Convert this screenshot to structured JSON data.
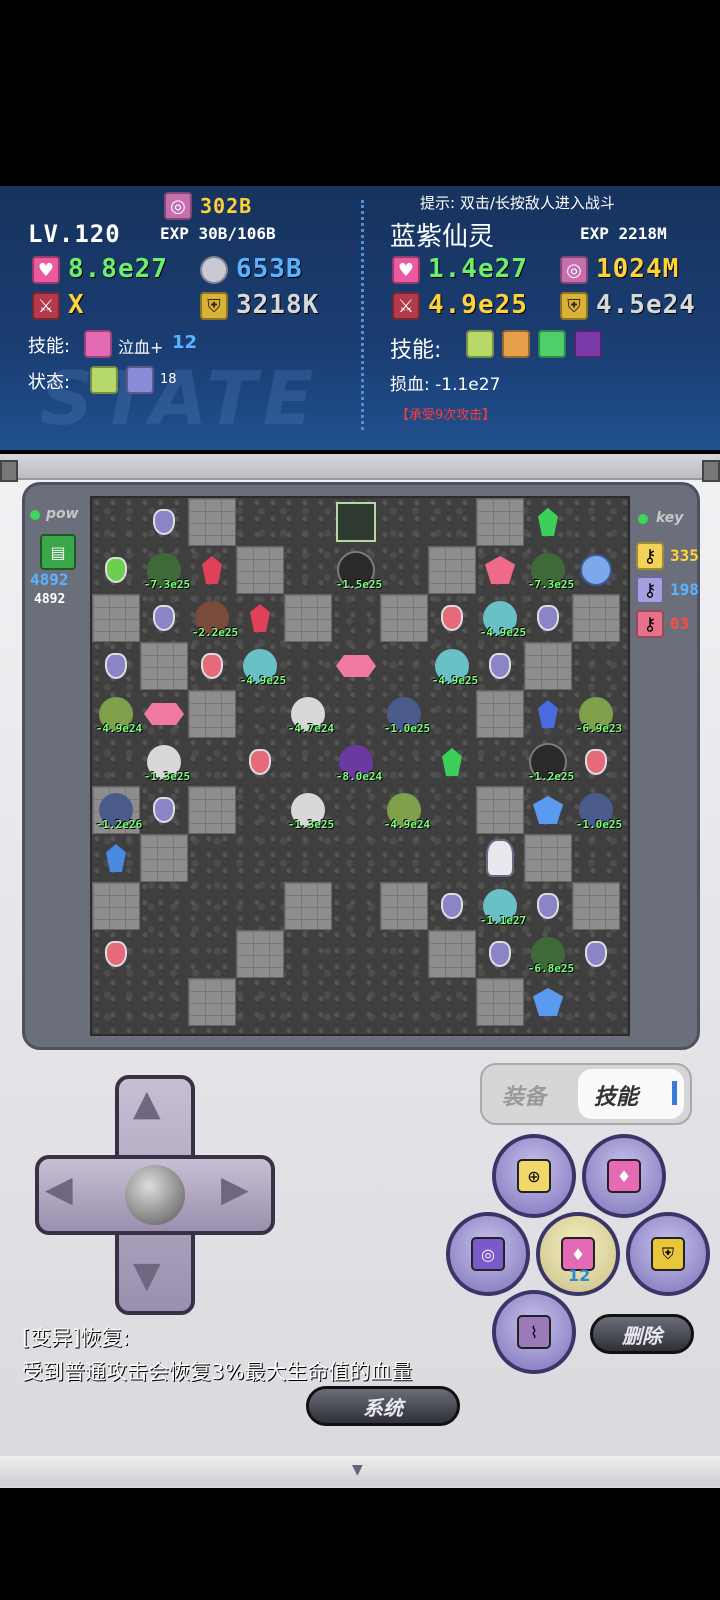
{
  "hero": {
    "gold": "302B",
    "level": "LV.120",
    "exp": "EXP 30B/106B",
    "hp": "8.8e27",
    "mdef": "653B",
    "atk": "X",
    "def": "3218K",
    "skill_label": "技能:",
    "skill_name": "泣血+",
    "skill_level": "12",
    "status_label": "状态:",
    "status_count": "18"
  },
  "enemy": {
    "hint": "提示: 双击/长按敌人进入战斗",
    "name": "蓝紫仙灵",
    "exp": "EXP 2218M",
    "hp": "1.4e27",
    "gold": "1024M",
    "atk": "4.9e25",
    "def": "4.5e24",
    "skill_label": "技能:",
    "damage_label": "损血: ",
    "damage": "-1.1e27",
    "hits": "【承受9次攻击】"
  },
  "watermark": "STATE",
  "side_left": {
    "label": "pow",
    "value1": "4892",
    "value2": "4892"
  },
  "side_right": {
    "label": "key",
    "yellow": "335",
    "blue": "198",
    "red": "03"
  },
  "monster_labels": {
    "m1": "-7.3e25",
    "m2": "-1.5e25",
    "m3": "-7.3e25",
    "m4": "-2.2e25",
    "m5": "-4.9e25",
    "m6": "-4.9e25",
    "m7": "-4.9e25",
    "m8": "-4.9e24",
    "m9": "-4.7e24",
    "m10": "-1.0e25",
    "m11": "-6.9e23",
    "m12": "-1.3e25",
    "m13": "-8.0e24",
    "m14": "-1.2e25",
    "m15": "-1.2e26",
    "m16": "-1.3e25",
    "m17": "-4.9e24",
    "m18": "-1.0e25",
    "m19": "-1.1e27",
    "m20": "-6.8e25"
  },
  "tabs": {
    "equip": "装备",
    "skill": "技能"
  },
  "skill_button_count": "12",
  "description": {
    "title": "[变异]恢复:",
    "body": "受到普通攻击会恢复3%最大生命值的血量"
  },
  "buttons": {
    "delete": "删除",
    "system": "系统"
  },
  "colors": {
    "hp": "#e95aa0",
    "atk": "#b23a4a",
    "def": "#d8b23a",
    "green_text": "#6cf06c",
    "blue_text": "#5bb3ff",
    "gold_text": "#ffd23a"
  }
}
